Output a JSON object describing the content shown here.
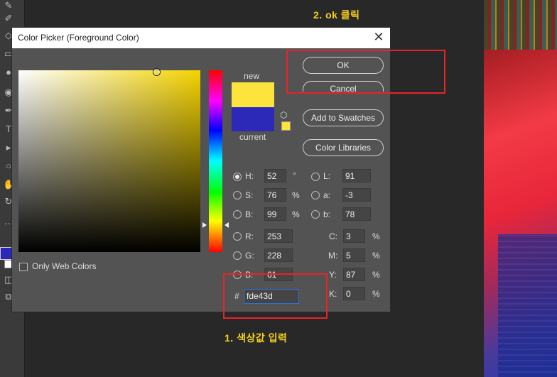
{
  "annotations": {
    "step_ok": "2. ok 클릭",
    "step_hex": "1. 색상값 입력"
  },
  "dialog": {
    "title": "Color Picker (Foreground Color)",
    "close_glyph": "✕",
    "new_label": "new",
    "current_label": "current",
    "buttons": {
      "ok": "OK",
      "cancel": "Cancel",
      "add_to_swatches": "Add to Swatches",
      "color_libraries": "Color Libraries"
    },
    "only_web_colors_label": "Only Web Colors",
    "hsb": {
      "h_label": "H:",
      "h_value": "52",
      "h_unit": "°",
      "s_label": "S:",
      "s_value": "76",
      "s_unit": "%",
      "b_label": "B:",
      "b_value": "99",
      "b_unit": "%"
    },
    "rgb": {
      "r_label": "R:",
      "r_value": "253",
      "g_label": "G:",
      "g_value": "228",
      "b_label": "B:",
      "b_value": "61"
    },
    "lab": {
      "l_label": "L:",
      "l_value": "91",
      "a_label": "a:",
      "a_value": "-3",
      "b_label": "b:",
      "b_value": "78"
    },
    "cmyk": {
      "c_label": "C:",
      "c_value": "3",
      "m_label": "M:",
      "m_value": "5",
      "y_label": "Y:",
      "y_value": "87",
      "k_label": "K:",
      "k_value": "0",
      "unit": "%"
    },
    "hex_prefix": "#",
    "hex_value": "fde43d",
    "new_color": "#fde43d",
    "current_color": "#2c29b8"
  },
  "colors": {
    "annotation_text": "#f5d11c",
    "annotation_box": "#e8232a",
    "dialog_bg": "#535353"
  }
}
